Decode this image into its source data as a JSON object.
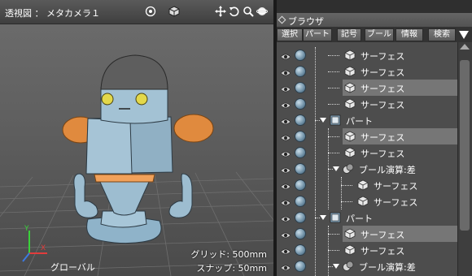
{
  "viewport": {
    "title": "透視図 ： メタカメラ１",
    "icons": [
      "target-icon",
      "cube-icon",
      "move-icon",
      "rotate-icon",
      "zoom-icon",
      "orbit-icon"
    ],
    "grid_text": "グリッド: 500mm",
    "snap_text": "スナップ: 50mm",
    "coord_label": "グローバル",
    "axis_labels": {
      "y": "Y",
      "x": "X"
    }
  },
  "browser": {
    "title": "ブラウザ",
    "tabs": [
      "選択",
      "パート",
      "記号",
      "ブール",
      "情報",
      "検索"
    ],
    "menu_icon": "triangle-down-icon",
    "items": [
      {
        "label": "サーフェス",
        "type": "surface",
        "depth": 1,
        "selected": false
      },
      {
        "label": "サーフェス",
        "type": "surface",
        "depth": 1,
        "selected": false
      },
      {
        "label": "サーフェス",
        "type": "surface",
        "depth": 1,
        "selected": true
      },
      {
        "label": "サーフェス",
        "type": "surface",
        "depth": 1,
        "selected": false
      },
      {
        "label": "パート",
        "type": "part",
        "depth": 0,
        "selected": false
      },
      {
        "label": "サーフェス",
        "type": "surface",
        "depth": 1,
        "selected": true
      },
      {
        "label": "サーフェス",
        "type": "surface",
        "depth": 1,
        "selected": false
      },
      {
        "label": "ブール演算:差",
        "type": "boolean",
        "depth": 1,
        "selected": false
      },
      {
        "label": "サーフェス",
        "type": "surface",
        "depth": 2,
        "selected": false
      },
      {
        "label": "サーフェス",
        "type": "surface",
        "depth": 2,
        "selected": false
      },
      {
        "label": "パート",
        "type": "part",
        "depth": 0,
        "selected": false
      },
      {
        "label": "サーフェス",
        "type": "surface",
        "depth": 1,
        "selected": true
      },
      {
        "label": "サーフェス",
        "type": "surface",
        "depth": 1,
        "selected": false
      },
      {
        "label": "ブール演算:差",
        "type": "boolean",
        "depth": 1,
        "selected": false
      }
    ]
  }
}
